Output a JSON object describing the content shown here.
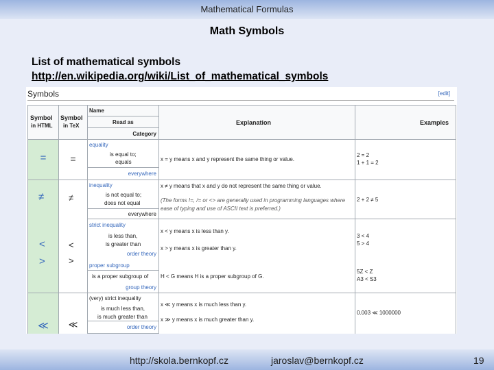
{
  "slide": {
    "header": "Mathematical Formulas",
    "title": "Math Symbols",
    "subtitle": "List of mathematical symbols",
    "link": "http://en.wikipedia.org/wiki/List_of_mathematical_symbols",
    "footer": {
      "url": "http://skola.bernkopf.cz",
      "email": "jaroslav@bernkopf.cz",
      "page": "19"
    }
  },
  "wiki": {
    "section": "Symbols",
    "edit": "[edit]",
    "headers": {
      "symbol_html_1": "Symbol",
      "symbol_html_2": "in HTML",
      "symbol_tex_1": "Symbol",
      "symbol_tex_2": "in TeX",
      "name": "Name",
      "read_as": "Read as",
      "category": "Category",
      "explanation": "Explanation",
      "examples": "Examples"
    },
    "rows": [
      {
        "html": "=",
        "tex": "=",
        "name": "equality",
        "read": "is equal to;",
        "read2": "equals",
        "category": "everywhere",
        "expl": "x = y means x and y represent the same thing or value.",
        "ex1": "2 = 2",
        "ex2": "1 + 1 = 2"
      },
      {
        "html": "≠",
        "tex": "≠",
        "name": "inequality",
        "read": "is not equal to;",
        "read2": "does not equal",
        "category": "everywhere",
        "expl": "x ≠ y means that x and y do not represent the same thing or value.",
        "expl2": "(The forms !=, /= or <> are generally used in programming languages where",
        "expl3": "ease of typing and use of ASCII text is preferred.)",
        "ex1": "2 + 2 ≠ 5"
      },
      {
        "html1": "<",
        "html2": ">",
        "tex1": "<",
        "tex2": ">",
        "name": "strict inequality",
        "read": "is less than,",
        "read2": "is greater than",
        "category": "order theory",
        "expl": "x < y means x is less than y.",
        "expl2": "x > y means x is greater than y.",
        "ex1": "3 < 4",
        "ex2": "5 > 4",
        "name2": "proper subgroup",
        "read3": "is a proper subgroup of",
        "category2": "group theory",
        "expl3": "H < G means H is a proper subgroup of G.",
        "ex3": "5Z < Z",
        "ex4": "A3 < S3"
      },
      {
        "html": "≪",
        "tex": "≪",
        "name": "(very) strict inequality",
        "read": "is much less than,",
        "read2": "is much greater than",
        "category": "order theory",
        "expl": "x ≪ y means x is much less than y.",
        "expl2": "x ≫ y means x is much greater than y.",
        "ex1": "0.003 ≪ 1000000"
      }
    ]
  }
}
